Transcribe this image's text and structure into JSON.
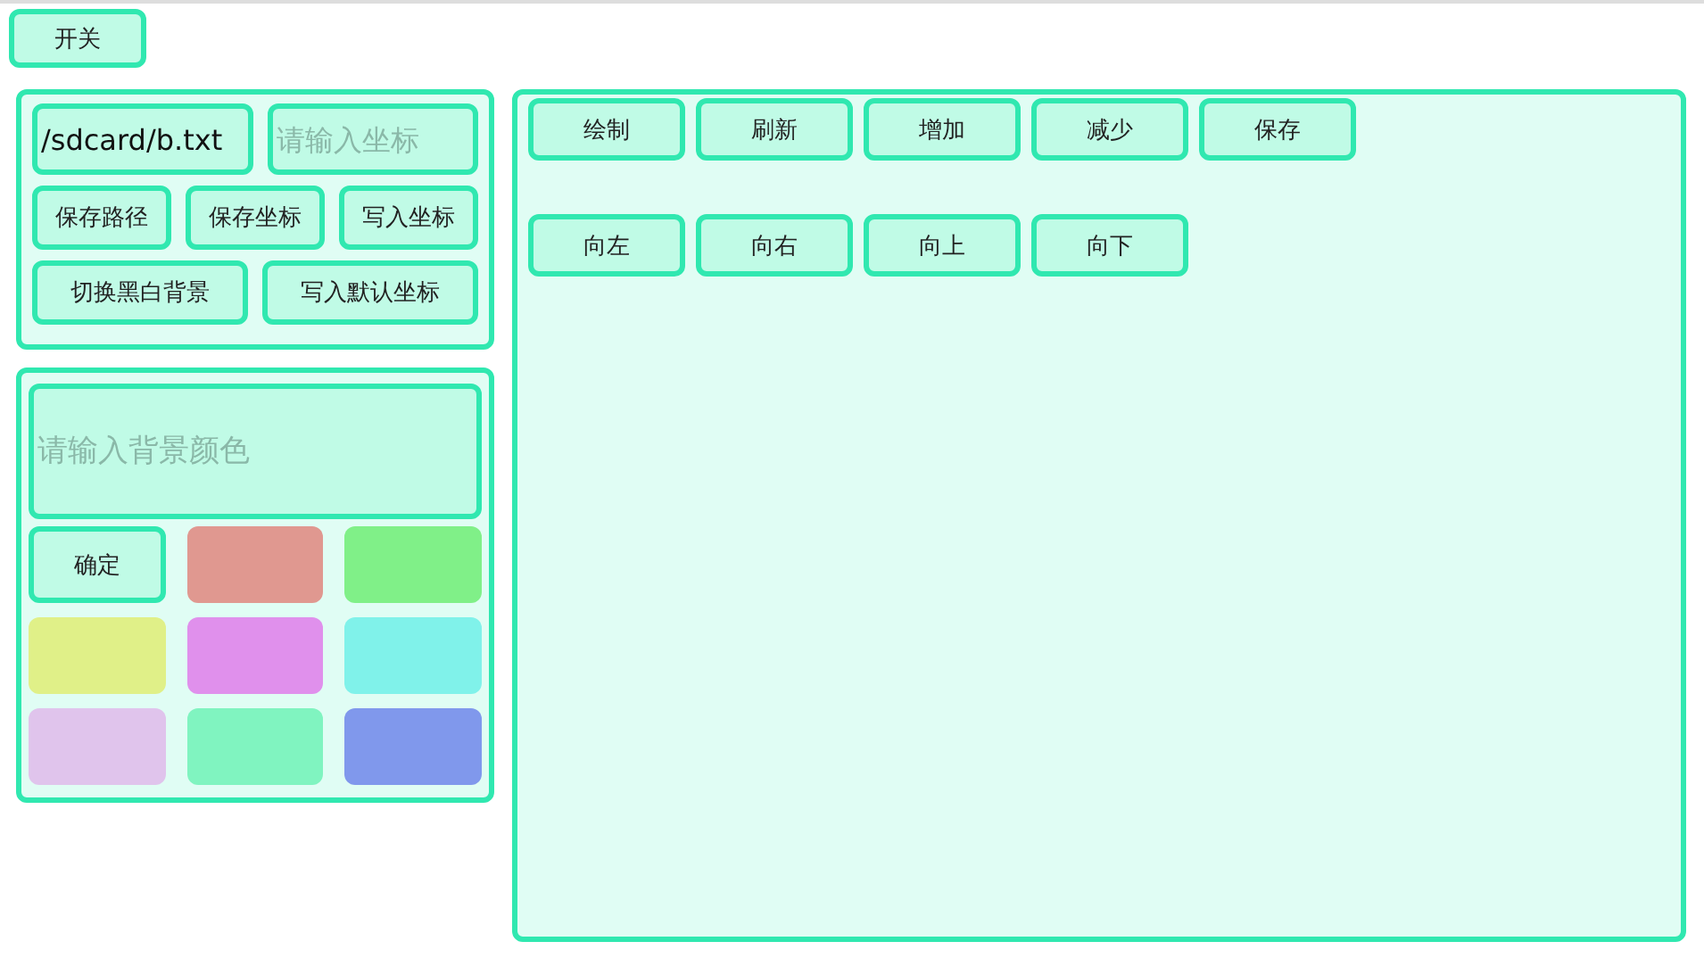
{
  "toggle_button": "开关",
  "file_panel": {
    "path_field": {
      "value": "/sdcard/b.txt"
    },
    "coord_field": {
      "placeholder": "请输入坐标"
    },
    "button_rows": [
      [
        "保存路径",
        "保存坐标",
        "写入坐标"
      ],
      [
        "切换黑白背景",
        "写入默认坐标"
      ]
    ]
  },
  "color_panel": {
    "color_field": {
      "placeholder": "请输入背景颜色"
    },
    "confirm_button": "确定",
    "swatches": [
      {
        "color": "#e09890"
      },
      {
        "color": "#80f088"
      },
      {
        "color": "#e0f088"
      },
      {
        "color": "#e090ec"
      },
      {
        "color": "#80f2ea"
      },
      {
        "color": "#e0c4ec"
      },
      {
        "color": "#80f4c0"
      },
      {
        "color": "#8098ec"
      }
    ]
  },
  "draw_panel": {
    "button_rows": [
      [
        "绘制",
        "刷新",
        "增加",
        "减少",
        "保存"
      ],
      [
        "向左",
        "向右",
        "向上",
        "向下"
      ]
    ]
  }
}
